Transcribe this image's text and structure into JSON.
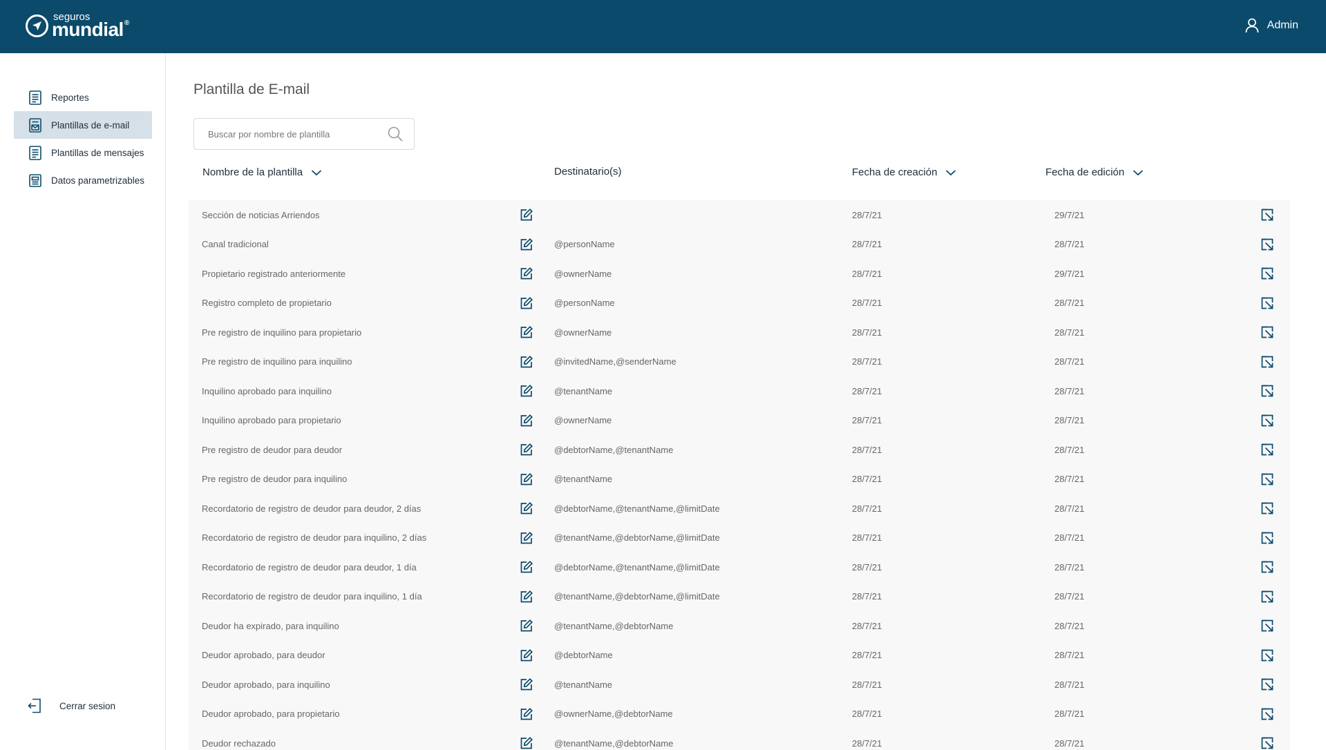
{
  "header": {
    "logo_small": "seguros",
    "logo_big": "mundial",
    "logo_reg": "®",
    "user_name": "Admin"
  },
  "sidebar": {
    "items": [
      {
        "label": "Reportes",
        "icon": "report-icon"
      },
      {
        "label": "Plantillas de e-mail",
        "icon": "email-template-icon",
        "active": true
      },
      {
        "label": "Plantillas de mensajes",
        "icon": "message-template-icon"
      },
      {
        "label": "Datos parametrizables",
        "icon": "data-icon"
      }
    ],
    "logout_label": "Cerrar sesion"
  },
  "main": {
    "title": "Plantilla de E-mail",
    "search_placeholder": "Buscar por nombre de plantilla",
    "columns": {
      "name": "Nombre de la plantilla",
      "recipients": "Destinatario(s)",
      "created": "Fecha de creación",
      "edited": "Fecha de edición"
    },
    "rows": [
      {
        "name": "Sección de noticias Arriendos",
        "recipients": "",
        "created": "28/7/21",
        "edited": "29/7/21"
      },
      {
        "name": "Canal tradicional",
        "recipients": "@personName",
        "created": "28/7/21",
        "edited": "28/7/21"
      },
      {
        "name": "Propietario registrado anteriormente",
        "recipients": "@ownerName",
        "created": "28/7/21",
        "edited": "29/7/21"
      },
      {
        "name": "Registro completo de propietario",
        "recipients": "@personName",
        "created": "28/7/21",
        "edited": "28/7/21"
      },
      {
        "name": "Pre registro de inquilino para propietario",
        "recipients": "@ownerName",
        "created": "28/7/21",
        "edited": "28/7/21"
      },
      {
        "name": "Pre registro de inquilino para inquilino",
        "recipients": "@invitedName,@senderName",
        "created": "28/7/21",
        "edited": "28/7/21"
      },
      {
        "name": "Inquilino aprobado para inquilino",
        "recipients": "@tenantName",
        "created": "28/7/21",
        "edited": "28/7/21"
      },
      {
        "name": "Inquilino aprobado para propietario",
        "recipients": "@ownerName",
        "created": "28/7/21",
        "edited": "28/7/21"
      },
      {
        "name": "Pre registro de deudor para deudor",
        "recipients": "@debtorName,@tenantName",
        "created": "28/7/21",
        "edited": "28/7/21"
      },
      {
        "name": "Pre registro de deudor para inquilino",
        "recipients": "@tenantName",
        "created": "28/7/21",
        "edited": "28/7/21"
      },
      {
        "name": "Recordatorio de registro de deudor para deudor, 2 días",
        "recipients": "@debtorName,@tenantName,@limitDate",
        "created": "28/7/21",
        "edited": "28/7/21"
      },
      {
        "name": "Recordatorio de registro de deudor para inquilino, 2 días",
        "recipients": "@tenantName,@debtorName,@limitDate",
        "created": "28/7/21",
        "edited": "28/7/21"
      },
      {
        "name": "Recordatorio de registro de deudor para deudor, 1 día",
        "recipients": "@debtorName,@tenantName,@limitDate",
        "created": "28/7/21",
        "edited": "28/7/21"
      },
      {
        "name": "Recordatorio de registro de deudor para inquilino, 1 día",
        "recipients": "@tenantName,@debtorName,@limitDate",
        "created": "28/7/21",
        "edited": "28/7/21"
      },
      {
        "name": "Deudor ha expirado, para inquilino",
        "recipients": "@tenantName,@debtorName",
        "created": "28/7/21",
        "edited": "28/7/21"
      },
      {
        "name": "Deudor aprobado, para deudor",
        "recipients": "@debtorName",
        "created": "28/7/21",
        "edited": "28/7/21"
      },
      {
        "name": "Deudor aprobado, para inquilino",
        "recipients": "@tenantName",
        "created": "28/7/21",
        "edited": "28/7/21"
      },
      {
        "name": "Deudor aprobado, para propietario",
        "recipients": "@ownerName,@debtorName",
        "created": "28/7/21",
        "edited": "28/7/21"
      },
      {
        "name": "Deudor rechazado",
        "recipients": "@tenantName,@debtorName",
        "created": "28/7/21",
        "edited": "28/7/21"
      }
    ]
  },
  "colors": {
    "header_bg": "#0b4a6b",
    "active_item_bg": "#d6e0e8",
    "icon_color": "#0b4a6b",
    "table_bg": "#f8f8f8"
  }
}
